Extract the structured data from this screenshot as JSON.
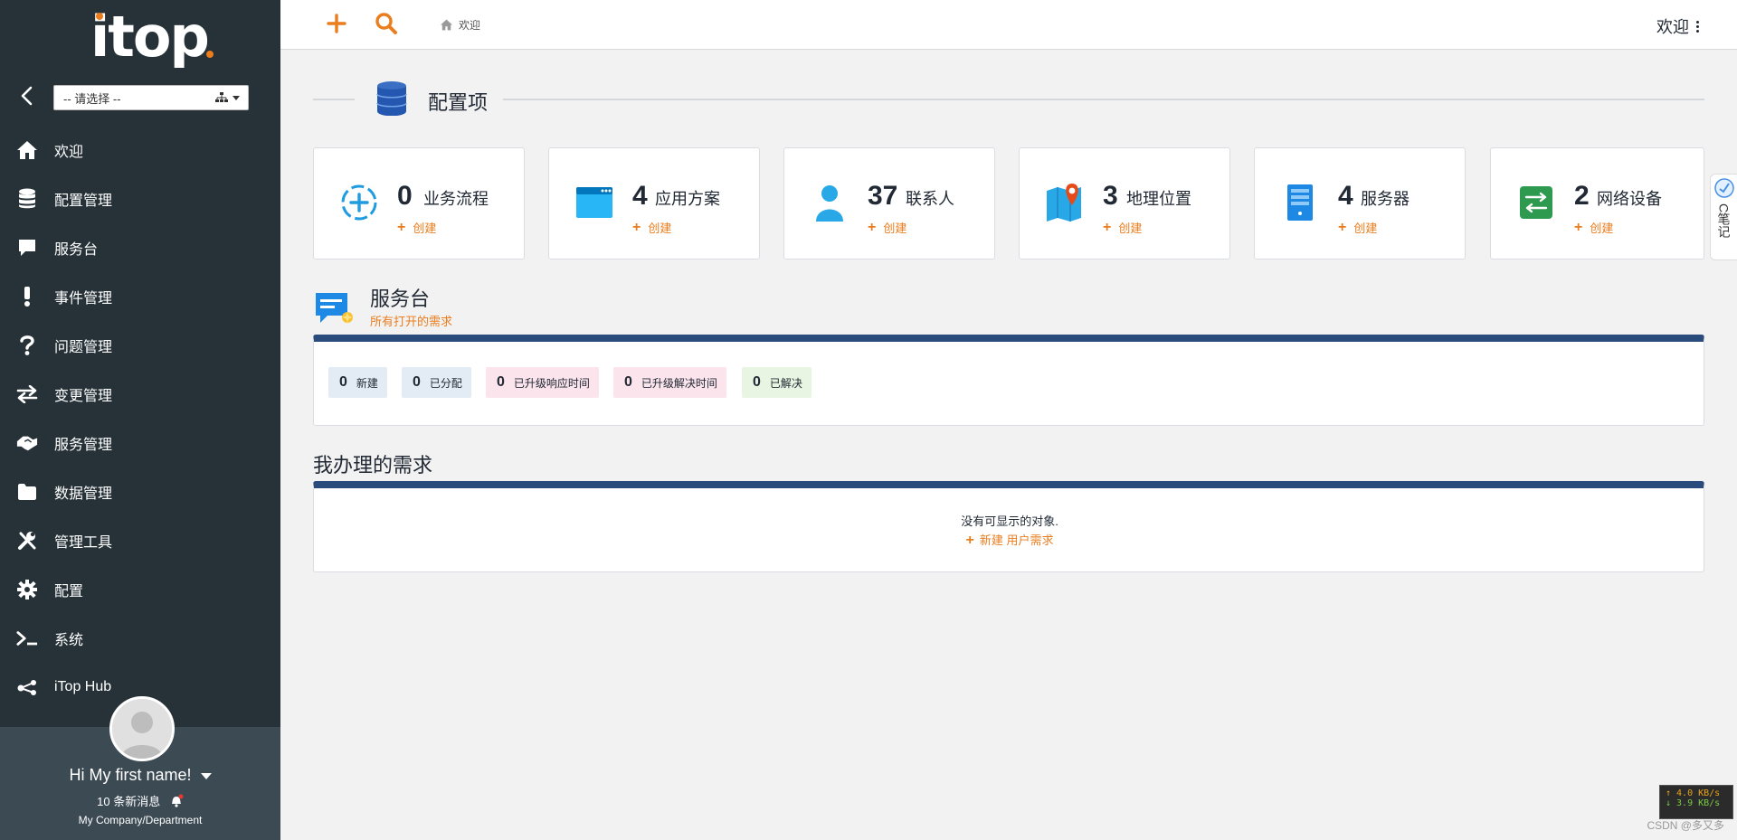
{
  "sidebar": {
    "logo_text": "itop",
    "org_select_value": "-- 请选择 --",
    "menu": [
      {
        "label": "欢迎",
        "icon": "home-icon"
      },
      {
        "label": "配置管理",
        "icon": "database-icon"
      },
      {
        "label": "服务台",
        "icon": "comment-icon"
      },
      {
        "label": "事件管理",
        "icon": "exclamation-icon"
      },
      {
        "label": "问题管理",
        "icon": "question-icon"
      },
      {
        "label": "变更管理",
        "icon": "exchange-icon"
      },
      {
        "label": "服务管理",
        "icon": "handshake-icon"
      },
      {
        "label": "数据管理",
        "icon": "folder-icon"
      },
      {
        "label": "管理工具",
        "icon": "tools-icon"
      },
      {
        "label": "配置",
        "icon": "gear-icon"
      },
      {
        "label": "系统",
        "icon": "terminal-icon"
      },
      {
        "label": "iTop Hub",
        "icon": "share-icon"
      }
    ],
    "user": {
      "greeting": "Hi My first name!",
      "messages": "10 条新消息",
      "organization": "My Company/Department"
    }
  },
  "topbar": {
    "breadcrumb": "欢迎",
    "welcome_menu": "欢迎"
  },
  "main": {
    "ci_section_title": "配置项",
    "cards": [
      {
        "count": "0",
        "label": "业务流程",
        "create": "创建",
        "icon": "business-process-icon"
      },
      {
        "count": "4",
        "label": "应用方案",
        "create": "创建",
        "icon": "application-window-icon"
      },
      {
        "count": "37",
        "label": "联系人",
        "create": "创建",
        "icon": "person-icon"
      },
      {
        "count": "3",
        "label": "地理位置",
        "create": "创建",
        "icon": "map-pin-icon"
      },
      {
        "count": "4",
        "label": "服务器",
        "create": "创建",
        "icon": "server-icon"
      },
      {
        "count": "2",
        "label": "网络设备",
        "create": "创建",
        "icon": "network-device-icon"
      }
    ],
    "service_desk": {
      "title": "服务台",
      "subtitle": "所有打开的需求",
      "badges": [
        {
          "count": "0",
          "label": "新建",
          "color": "#e3ebf5"
        },
        {
          "count": "0",
          "label": "已分配",
          "color": "#e3ebf5"
        },
        {
          "count": "0",
          "label": "已升级响应时间",
          "color": "#fbe4ec"
        },
        {
          "count": "0",
          "label": "已升级解决时间",
          "color": "#fbe4ec"
        },
        {
          "count": "0",
          "label": "已解决",
          "color": "#e8f5e2"
        }
      ]
    },
    "my_requests": {
      "title": "我办理的需求",
      "empty_text": "没有可显示的对象.",
      "new_request": "新建 用户需求"
    }
  },
  "overlays": {
    "side_note": "C笔记",
    "net_up": "↑ 4.0 KB/s",
    "net_down": "↓ 3.9 KB/s",
    "watermark": "CSDN @多又多"
  },
  "colors": {
    "sidebar_bg": "#263238",
    "accent_orange": "#ea7d1e",
    "panel_bar": "#2a4c7c"
  }
}
